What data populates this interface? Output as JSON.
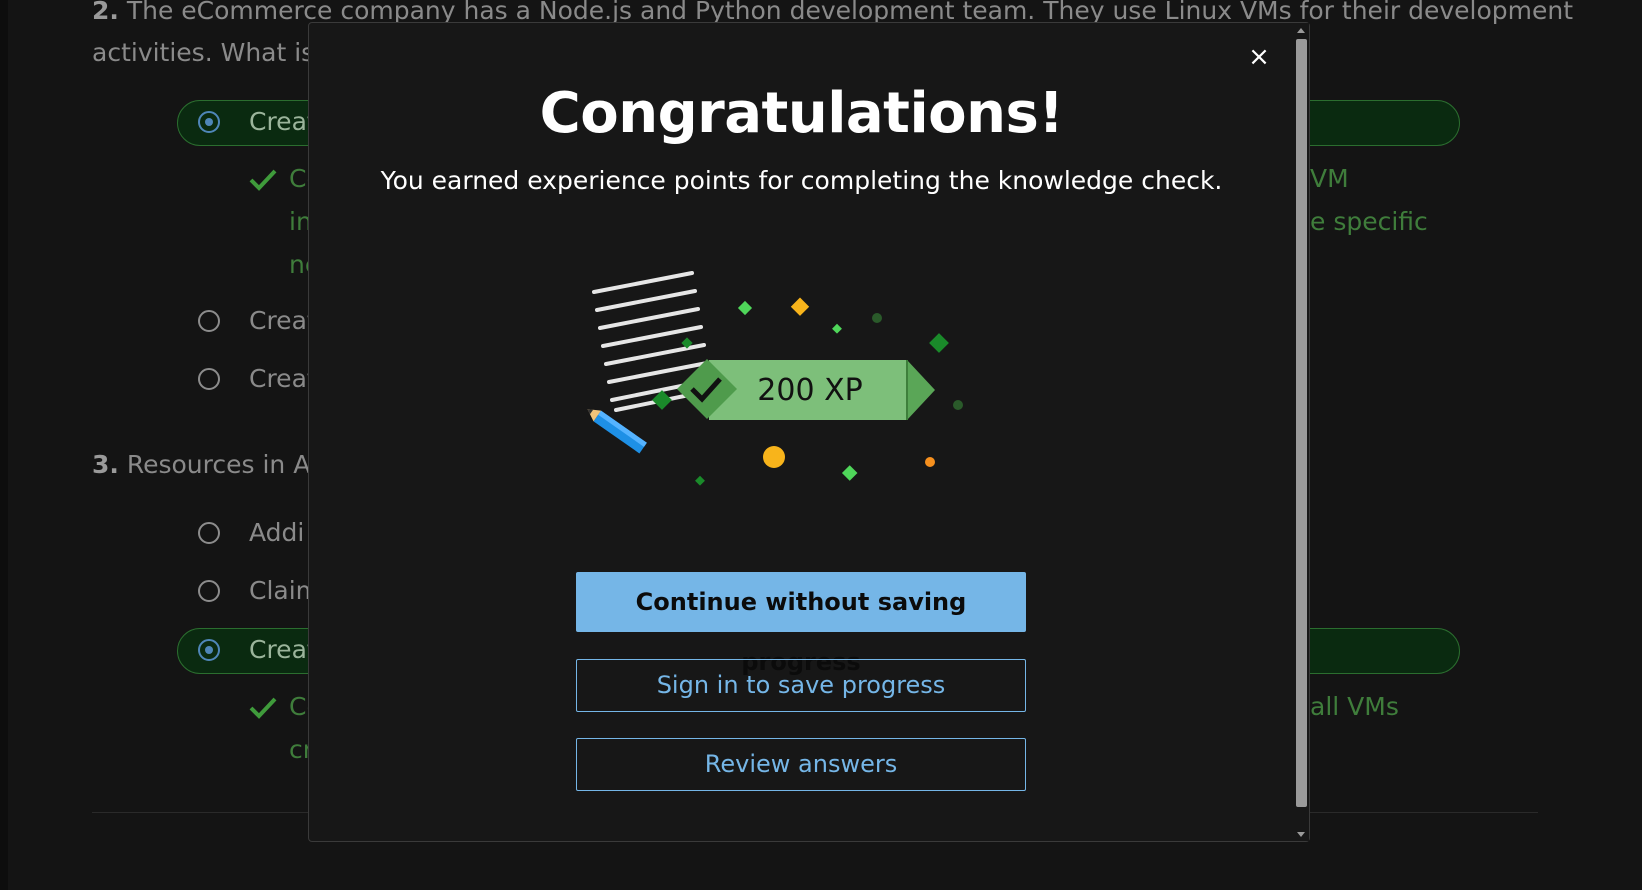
{
  "background": {
    "q2_line1_num": "2.",
    "q2_line1": "The eCommerce company has a Node.js and Python development team. They use Linux VMs for their development",
    "q2_line2": "activities. What is t",
    "q2_options": [
      "Creat",
      "Creat",
      "Creat"
    ],
    "q2_feedback_left": [
      "Co",
      "in",
      "ne"
    ],
    "q2_feedback_right": [
      "VM",
      "e specific"
    ],
    "q3_num": "3.",
    "q3_text": "Resources in Azu",
    "q3_options": [
      "Addi",
      "Claim",
      "Creat"
    ],
    "q3_feedback_left": [
      "Co",
      "cr"
    ],
    "q3_feedback_right": "all VMs"
  },
  "modal": {
    "close_label": "×",
    "title": "Congratulations!",
    "subtitle": "You earned experience points for completing the knowledge check.",
    "xp_label": "200 XP",
    "buttons": {
      "continue": "Continue without saving progress",
      "sign_in": "Sign in to save progress",
      "review": "Review answers"
    }
  },
  "colors": {
    "accent": "#75b6e7",
    "badge_green": "#7dbf7a",
    "badge_dark_green": "#4f9b4c",
    "confetti_yellow": "#f8b41b"
  }
}
